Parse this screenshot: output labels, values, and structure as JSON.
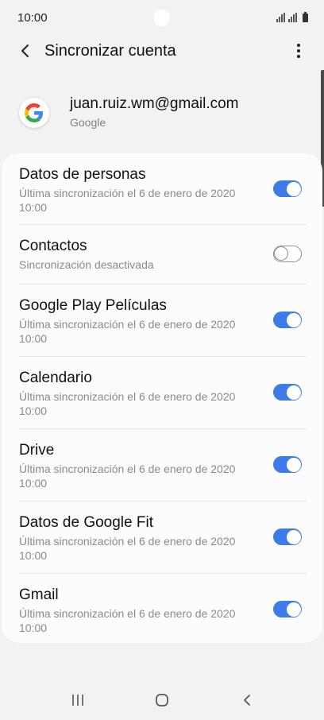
{
  "status_bar": {
    "time": "10:00"
  },
  "app_bar": {
    "title": "Sincronizar cuenta",
    "back_icon": "chevron-left-icon",
    "more_icon": "more-vertical-icon"
  },
  "account": {
    "email": "juan.ruiz.wm@gmail.com",
    "type": "Google",
    "logo_icon": "google-logo-icon"
  },
  "sync_items": [
    {
      "title": "Datos de personas",
      "subtitle": "Última sincronización el 6 de enero de 2020 10:00",
      "enabled": true
    },
    {
      "title": "Contactos",
      "subtitle": "Sincronización desactivada",
      "enabled": false
    },
    {
      "title": "Google Play Películas",
      "subtitle": "Última sincronización el 6 de enero de 2020 10:00",
      "enabled": true
    },
    {
      "title": "Calendario",
      "subtitle": "Última sincronización el 6 de enero de 2020 10:00",
      "enabled": true
    },
    {
      "title": "Drive",
      "subtitle": "Última sincronización el 6 de enero de 2020 10:00",
      "enabled": true
    },
    {
      "title": "Datos de Google Fit",
      "subtitle": "Última sincronización el 6 de enero de 2020 10:00",
      "enabled": true
    },
    {
      "title": "Gmail",
      "subtitle": "Última sincronización el 6 de enero de 2020 10:00",
      "enabled": true
    }
  ],
  "nav_bar": {
    "recents_icon": "recents-icon",
    "home_icon": "home-icon",
    "back_icon": "back-icon"
  },
  "colors": {
    "accent": "#3e7bea",
    "background": "#f2f2f2",
    "card": "#fcfcfc",
    "secondary_text": "#8a8a8a"
  }
}
